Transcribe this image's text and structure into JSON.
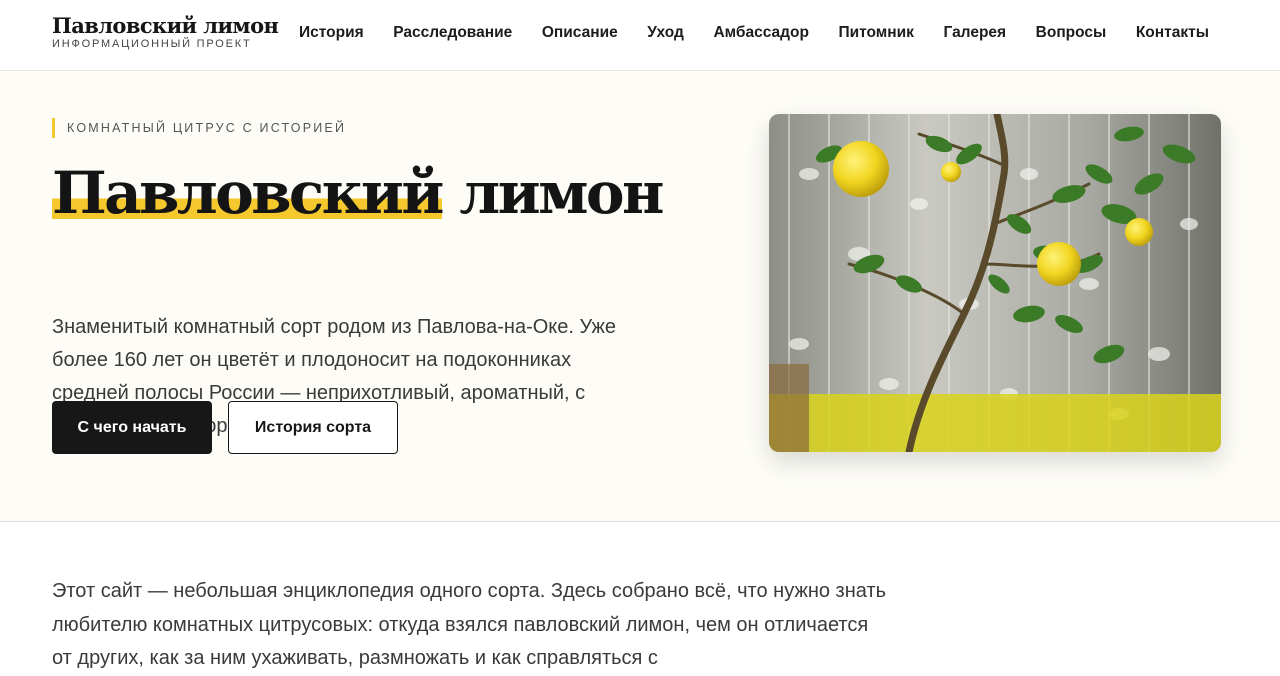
{
  "header": {
    "logo_title": "Павловский лимон",
    "logo_subtitle": "ИНФОРМАЦИОННЫЙ ПРОЕКТ",
    "nav": [
      "История",
      "Расследование",
      "Описание",
      "Уход",
      "Амбассадор",
      "Питомник",
      "Галерея",
      "Вопросы",
      "Контакты"
    ]
  },
  "hero": {
    "eyebrow": "КОМНАТНЫЙ ЦИТРУС С ИСТОРИЕЙ",
    "title_highlight": "Павловский",
    "title_rest": " лимон",
    "description": "Знаменитый комнатный сорт родом из Павлова-на-Оке. Уже более 160 лет он цветёт и плодоносит на подоконниках средней полосы России — неприхотливый, ароматный, с собственной историей.",
    "primary_button": "С чего начать",
    "secondary_button": "История сорта",
    "accent_color": "#f5c92e"
  },
  "intro": {
    "text": "Этот сайт — небольшая энциклопедия одного сорта. Здесь собрано всё, что нужно знать любителю комнатных цитрусовых: откуда взялся павловский лимон, чем он отличается от других, как за ним ухаживать, размножать и как справляться с"
  }
}
